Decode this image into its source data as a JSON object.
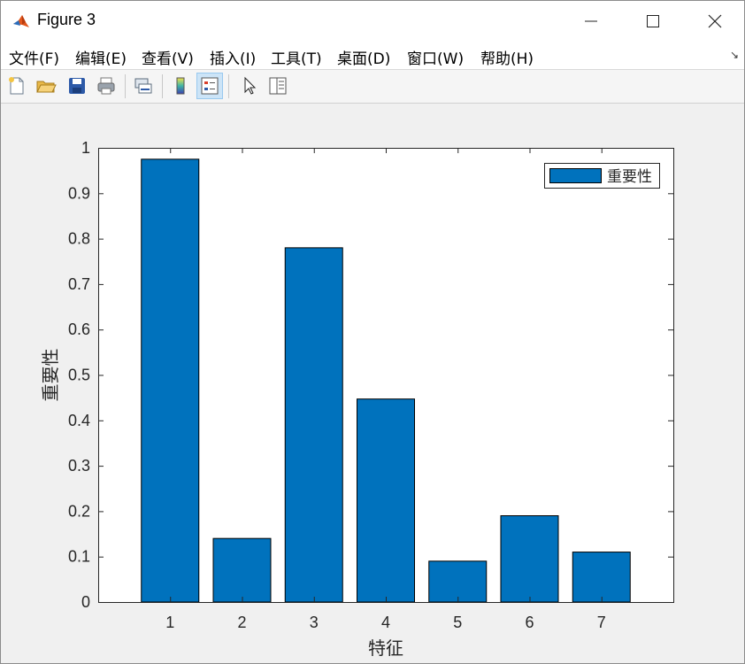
{
  "window": {
    "title": "Figure 3",
    "minimize": "—",
    "maximize": "☐",
    "close": "✕"
  },
  "menu": [
    {
      "label": "文件(F)"
    },
    {
      "label": "编辑(E)"
    },
    {
      "label": "查看(V)"
    },
    {
      "label": "插入(I)"
    },
    {
      "label": "工具(T)"
    },
    {
      "label": "桌面(D)"
    },
    {
      "label": "窗口(W)"
    },
    {
      "label": "帮助(H)"
    }
  ],
  "toolbar": {
    "icons": [
      "new-figure-icon",
      "open-file-icon",
      "save-icon",
      "print-icon",
      "link-plot-icon",
      "colorbar-icon",
      "legend-icon",
      "edit-plot-arrow-icon",
      "property-inspector-icon"
    ]
  },
  "colors": {
    "bar_fill": "#0072bd",
    "bar_edge": "#000000",
    "axes_bg": "#ffffff",
    "figure_bg": "#f0f0f0"
  },
  "chart_data": {
    "type": "bar",
    "categories": [
      "1",
      "2",
      "3",
      "4",
      "5",
      "6",
      "7"
    ],
    "series": [
      {
        "name": "重要性",
        "values": [
          0.975,
          0.14,
          0.78,
          0.447,
          0.09,
          0.19,
          0.11
        ]
      }
    ],
    "xlabel": "特征",
    "ylabel": "重要性",
    "xlim": [
      0,
      8
    ],
    "ylim": [
      0,
      1
    ],
    "yticks": [
      "0",
      "0.1",
      "0.2",
      "0.3",
      "0.4",
      "0.5",
      "0.6",
      "0.7",
      "0.8",
      "0.9",
      "1"
    ],
    "grid": false,
    "legend_position": "top-right"
  }
}
